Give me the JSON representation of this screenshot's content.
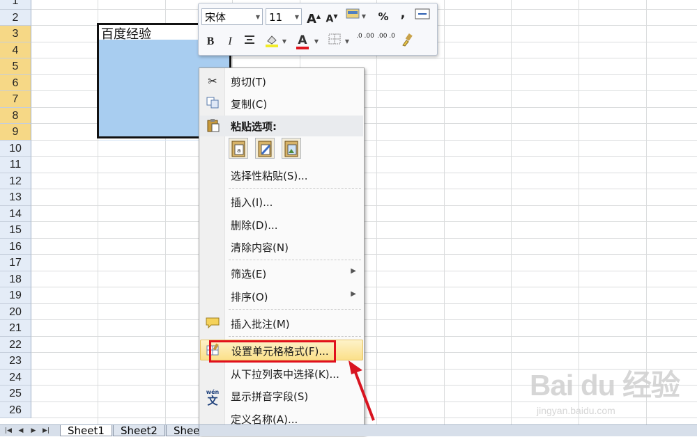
{
  "rows": [
    "1",
    "2",
    "3",
    "4",
    "5",
    "6",
    "7",
    "8",
    "9",
    "10",
    "11",
    "12",
    "13",
    "14",
    "15",
    "16",
    "17",
    "18",
    "19",
    "20",
    "21",
    "22",
    "23",
    "24",
    "25",
    "26"
  ],
  "cell_a3": "百度经验",
  "mini_toolbar": {
    "font_name": "宋体",
    "font_size": "11",
    "grow_font": "A",
    "shrink_font": "A",
    "percent": "%",
    "comma": ",",
    "bold": "B",
    "italic": "I",
    "font_color": "A",
    "dec_increase": ".0 .00",
    "dec_decrease": ".00 .0"
  },
  "menu": {
    "cut": "剪切(T)",
    "copy": "复制(C)",
    "paste_options": "粘贴选项:",
    "paste_special": "选择性粘贴(S)...",
    "insert": "插入(I)...",
    "delete": "删除(D)...",
    "clear": "清除内容(N)",
    "filter": "筛选(E)",
    "sort": "排序(O)",
    "insert_comment": "插入批注(M)",
    "format_cells": "设置单元格格式(F)...",
    "pick_list": "从下拉列表中选择(K)...",
    "phonetic": "显示拼音字段(S)",
    "define_name": "定义名称(A)..."
  },
  "sheet_tabs": [
    "Sheet1",
    "Sheet2",
    "Shee"
  ],
  "watermark": {
    "logo": "Bai du 经验",
    "url": "jingyan.baidu.com"
  },
  "colors": {
    "selection": "#a8cdf0",
    "header_selected": "#f6d886",
    "highlight_box": "#e1101c"
  }
}
